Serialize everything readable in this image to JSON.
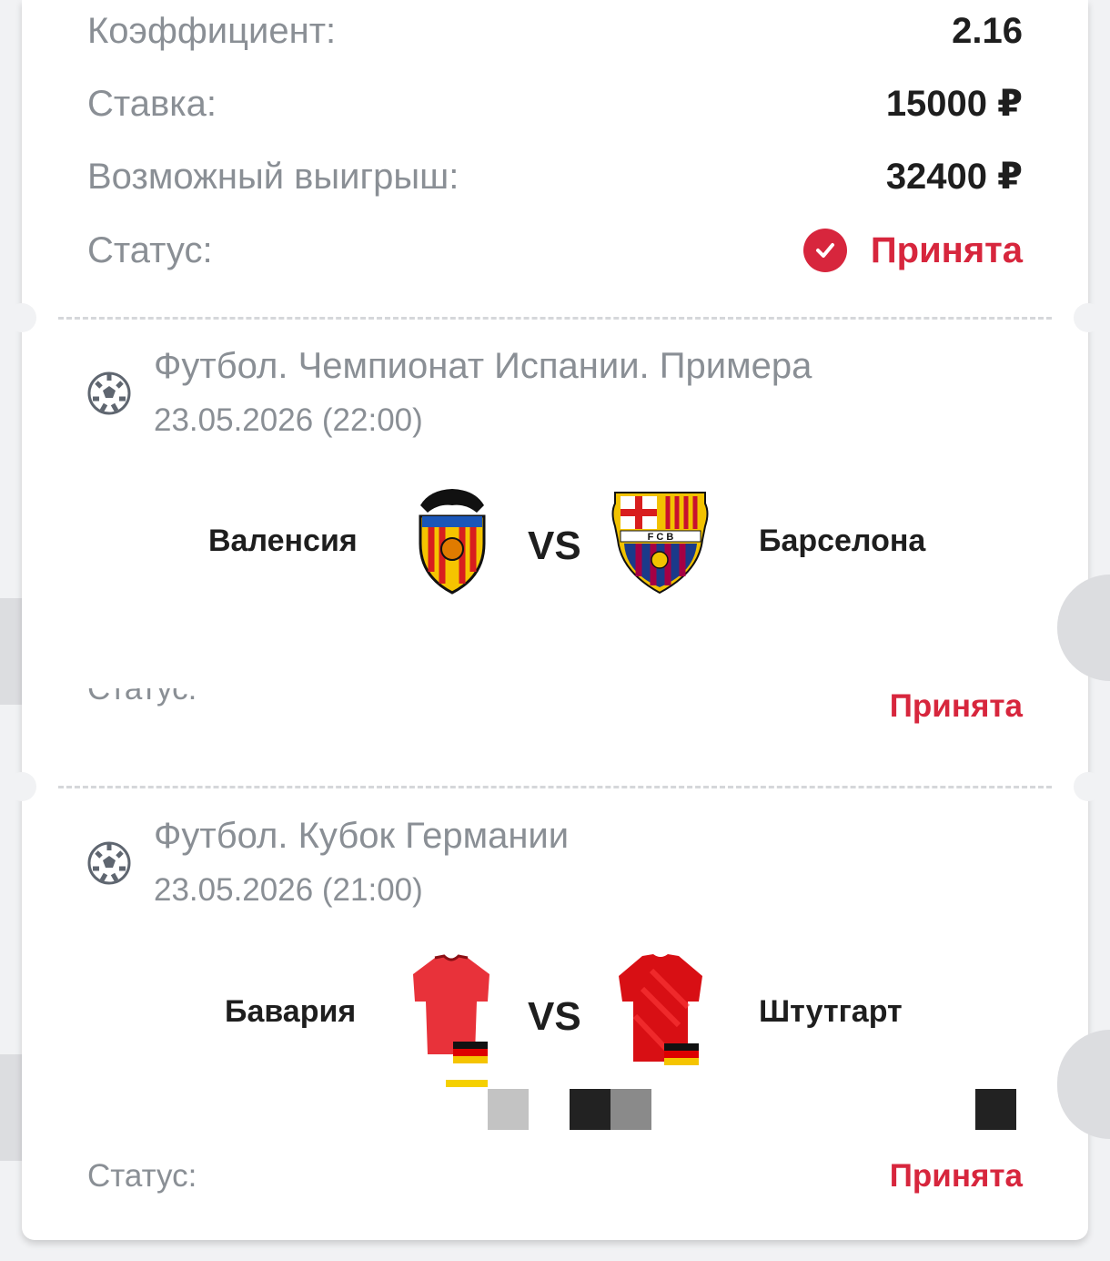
{
  "summary": {
    "coef_label": "Коэффициент:",
    "coef_value": "2.16",
    "stake_label": "Ставка:",
    "stake_value": "15000 ₽",
    "win_label": "Возможный выигрыш:",
    "win_value": "32400 ₽",
    "status_label": "Статус:",
    "status_value": "Принята"
  },
  "events": [
    {
      "league": "Футбол. Чемпионат Испании. Примера",
      "date": "23.05.2026 (22:00)",
      "home": "Валенсия",
      "away": "Барселона",
      "vs": "VS",
      "status_label": "Статус:",
      "status_value": "Принята",
      "icon": "soccer-ball-icon"
    },
    {
      "league": "Футбол. Кубок Германии",
      "date": "23.05.2026 (21:00)",
      "home": "Бавария",
      "away": "Штутгарт",
      "vs": "VS",
      "status_label": "Статус:",
      "status_value": "Принята",
      "icon": "soccer-ball-icon"
    }
  ],
  "colors": {
    "accent_red": "#d7263d",
    "muted_text": "#8a8f95",
    "primary_text": "#1e1e1e"
  }
}
